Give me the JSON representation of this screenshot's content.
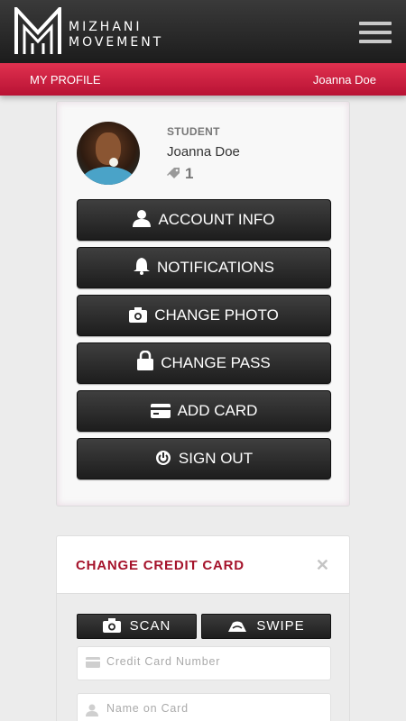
{
  "header": {
    "brand_line1": "MIZHANI",
    "brand_line2": "MOVEMENT",
    "menu_icon": "hamburger-menu-icon"
  },
  "subbar": {
    "title": "MY PROFILE",
    "user": "Joanna Doe"
  },
  "profile": {
    "role": "STUDENT",
    "name": "Joanna Doe",
    "pass_count": "1",
    "pass_icon": "ticket-icon"
  },
  "menu": [
    {
      "label": "ACCOUNT INFO",
      "icon": "user-icon"
    },
    {
      "label": "NOTIFICATIONS",
      "icon": "bell-icon"
    },
    {
      "label": "CHANGE PHOTO",
      "icon": "camera-icon"
    },
    {
      "label": "CHANGE PASS",
      "icon": "lock-icon"
    },
    {
      "label": "ADD CARD",
      "icon": "credit-card-icon"
    },
    {
      "label": "SIGN OUT",
      "icon": "power-icon"
    }
  ],
  "credit_card": {
    "title": "CHANGE CREDIT CARD",
    "scan_label": "SCAN",
    "swipe_label": "SWIPE",
    "card_number_placeholder": "Credit Card Number",
    "name_placeholder": "Name on Card"
  },
  "colors": {
    "accent": "#c8163a",
    "title_red": "#a5132b",
    "button_dark": "#262626"
  }
}
